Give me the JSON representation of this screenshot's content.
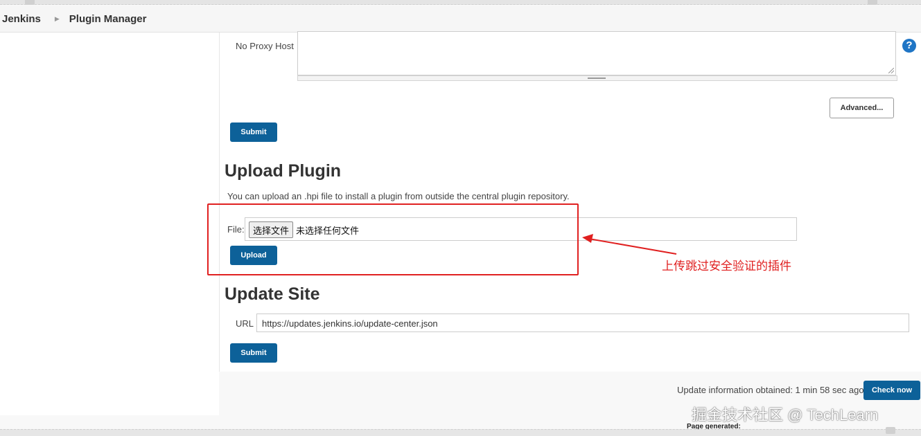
{
  "breadcrumb": {
    "items": [
      "Jenkins",
      "Plugin Manager"
    ]
  },
  "proxy": {
    "no_proxy_label": "No Proxy Host",
    "no_proxy_value": "",
    "help": "?",
    "advanced_label": "Advanced...",
    "submit_label": "Submit"
  },
  "upload": {
    "title": "Upload Plugin",
    "description": "You can upload an .hpi file to install a plugin from outside the central plugin repository.",
    "file_label": "File:",
    "choose_button": "选择文件",
    "no_file_text": "未选择任何文件",
    "upload_label": "Upload"
  },
  "annotation": {
    "text": "上传跳过安全验证的插件",
    "color": "#e02020"
  },
  "update_site": {
    "title": "Update Site",
    "url_label": "URL",
    "url_value": "https://updates.jenkins.io/update-center.json",
    "submit_label": "Submit"
  },
  "footer": {
    "update_info": "Update information obtained: 1 min 58 sec ago",
    "check_now": "Check now",
    "page_generated": "Page generated:"
  },
  "watermark": "掘金技术社区 @ TechLearn",
  "colors": {
    "primary": "#0d6199",
    "help": "#1f75c5",
    "annotation": "#e02020"
  }
}
